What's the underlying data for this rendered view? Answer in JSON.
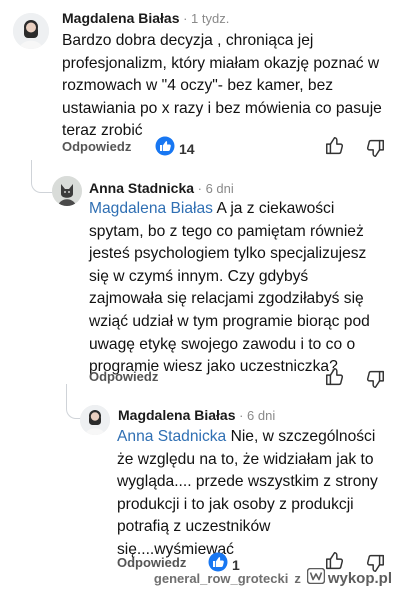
{
  "comments": [
    {
      "author": "Magdalena Białas",
      "time": " · 1 tydz.",
      "lines": [
        "Bardzo dobra decyzja , chroniąca jej",
        "profesjonalizm, który miałam okazję poznać w",
        "rozmowach w \"4 oczy\"- bez kamer, bez",
        "ustawiania po x razy i bez mówienia co pasuje",
        "teraz zrobić"
      ],
      "reply_label": "Odpowiedz",
      "reaction_count": "14",
      "reaction_icon": "like-bubble-icon"
    },
    {
      "author": "Anna Stadnicka",
      "time": " · 6 dni",
      "mention": "Magdalena Białas",
      "lines": [
        " A ja z ciekawości",
        "spytam, bo z tego co pamiętam również",
        "jesteś psychologiem tylko specjalizujesz",
        "się w czymś innym. Czy gdybyś",
        "zajmowała się relacjami zgodziłabyś się",
        "wziąć udział w tym programie biorąc pod",
        "uwagę etykę swojego zawodu i to co o",
        "programie wiesz jako uczestniczka?"
      ],
      "reply_label": "Odpowiedz"
    },
    {
      "author": "Magdalena Białas",
      "time": " · 6 dni",
      "mention": "Anna Stadnicka",
      "lines": [
        " Nie, w szczególności",
        "że względu na to, że widziałam jak to",
        "wygląda.... przede wszystkim z strony",
        "produkcji i to jak osoby z produkcji",
        "potrafią z uczestników",
        "się....wyśmiewać"
      ],
      "reply_label": "Odpowiedz",
      "reaction_count": "1",
      "reaction_icon": "like-bubble-icon"
    }
  ],
  "watermark": {
    "user": "general_row_grotecki",
    "separator": "z",
    "site": "wykop.pl"
  },
  "colors": {
    "mention": "#2f6fb3",
    "like_blue": "#1877f2"
  }
}
